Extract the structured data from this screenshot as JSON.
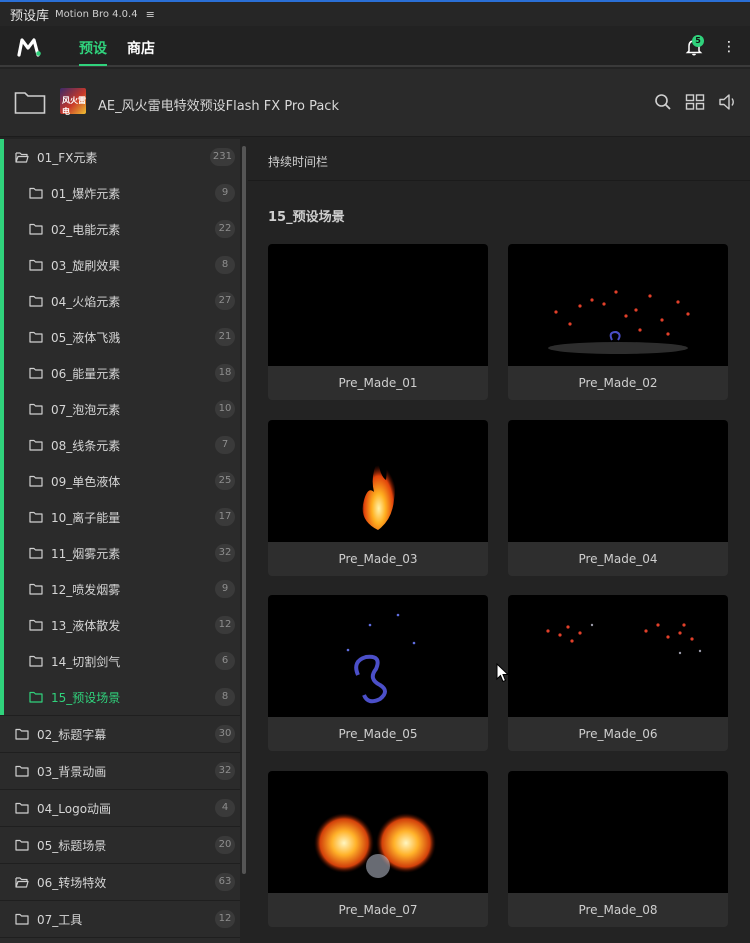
{
  "titlebar": {
    "app_title": "预设库",
    "app_version": "Motion Bro 4.0.4",
    "menu_glyph": "≡"
  },
  "nav": {
    "tab_presets": "预设",
    "tab_store": "商店",
    "notification_count": "5",
    "more_glyph": "⋮"
  },
  "pack": {
    "name": "AE_风火雷电特效预设Flash FX Pro Pack",
    "thumb_text": "风火雷电"
  },
  "colors": {
    "accent": "#30d27c",
    "background": "#232323",
    "sidebar": "#2b2b2b"
  },
  "icons": [
    "folder-icon",
    "search-icon",
    "grid-view-icon",
    "volume-icon",
    "bell-icon",
    "more-icon"
  ],
  "sidebar": {
    "items": [
      {
        "label": "01_FX元素",
        "count": "231",
        "level": 0,
        "expanded": true
      },
      {
        "label": "01_爆炸元素",
        "count": "9",
        "level": 1
      },
      {
        "label": "02_电能元素",
        "count": "22",
        "level": 1
      },
      {
        "label": "03_旋刷效果",
        "count": "8",
        "level": 1
      },
      {
        "label": "04_火焰元素",
        "count": "27",
        "level": 1
      },
      {
        "label": "05_液体飞溅",
        "count": "21",
        "level": 1
      },
      {
        "label": "06_能量元素",
        "count": "18",
        "level": 1
      },
      {
        "label": "07_泡泡元素",
        "count": "10",
        "level": 1
      },
      {
        "label": "08_线条元素",
        "count": "7",
        "level": 1
      },
      {
        "label": "09_单色液体",
        "count": "25",
        "level": 1
      },
      {
        "label": "10_离子能量",
        "count": "17",
        "level": 1
      },
      {
        "label": "11_烟雾元素",
        "count": "32",
        "level": 1
      },
      {
        "label": "12_喷发烟雾",
        "count": "9",
        "level": 1
      },
      {
        "label": "13_液体散发",
        "count": "12",
        "level": 1
      },
      {
        "label": "14_切割剑气",
        "count": "6",
        "level": 1
      },
      {
        "label": "15_预设场景",
        "count": "8",
        "level": 1,
        "selected": true
      },
      {
        "label": "02_标题字幕",
        "count": "30",
        "level": 0
      },
      {
        "label": "03_背景动画",
        "count": "32",
        "level": 0
      },
      {
        "label": "04_Logo动画",
        "count": "4",
        "level": 0
      },
      {
        "label": "05_标题场景",
        "count": "20",
        "level": 0
      },
      {
        "label": "06_转场特效",
        "count": "63",
        "level": 0,
        "expanded": true
      },
      {
        "label": "07_工具",
        "count": "12",
        "level": 0
      }
    ]
  },
  "content": {
    "duration_bar": "持续时间栏",
    "section_title": "15_预设场景",
    "presets": [
      {
        "name": "Pre_Made_01",
        "effect": "empty"
      },
      {
        "name": "Pre_Made_02",
        "effect": "sparks-smoke"
      },
      {
        "name": "Pre_Made_03",
        "effect": "fire"
      },
      {
        "name": "Pre_Made_04",
        "effect": "empty"
      },
      {
        "name": "Pre_Made_05",
        "effect": "blue-swirl"
      },
      {
        "name": "Pre_Made_06",
        "effect": "red-sparks"
      },
      {
        "name": "Pre_Made_07",
        "effect": "fire-burst"
      },
      {
        "name": "Pre_Made_08",
        "effect": "empty"
      }
    ]
  }
}
